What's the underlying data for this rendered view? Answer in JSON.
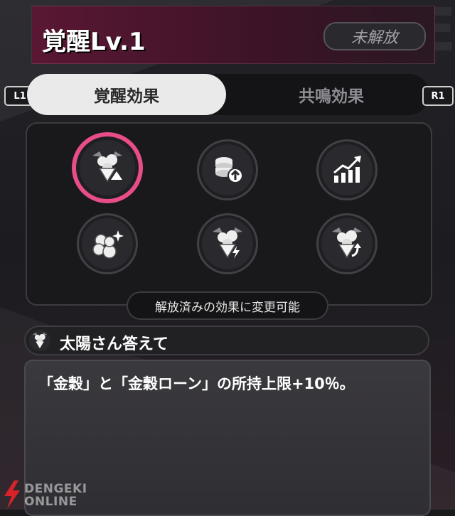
{
  "header": {
    "title": "覚醒Lv.1",
    "status": "未解放",
    "accent_color": "#5a1734"
  },
  "tabs": {
    "left_button": "L1",
    "right_button": "R1",
    "active_label": "覚醒効果",
    "inactive_label": "共鳴効果"
  },
  "effects": {
    "selected_color": "#e84d8a",
    "items": [
      {
        "icon": "bouquet-up-icon",
        "selected": true
      },
      {
        "icon": "coins-up-icon",
        "selected": false
      },
      {
        "icon": "growth-chart-icon",
        "selected": false
      },
      {
        "icon": "orbs-sparkle-icon",
        "selected": false
      },
      {
        "icon": "bouquet-bolt-icon",
        "selected": false
      },
      {
        "icon": "bouquet-arrow-icon",
        "selected": false
      }
    ],
    "note": "解放済みの効果に変更可能"
  },
  "detail": {
    "icon": "bouquet-icon",
    "name": "太陽さん答えて",
    "description": "「金穀」と「金穀ローン」の所持上限+10％。"
  },
  "watermark": {
    "line1": "DENGEKI",
    "line2": "ONLINE"
  }
}
